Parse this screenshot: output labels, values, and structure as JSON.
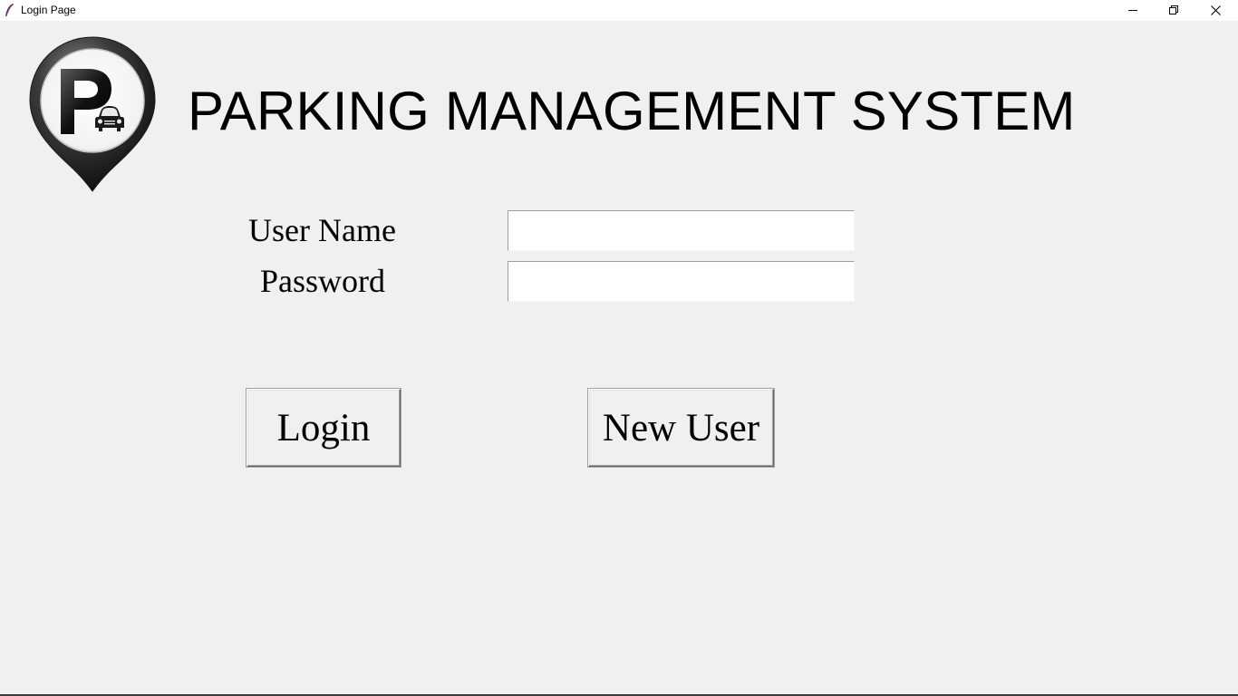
{
  "window": {
    "title": "Login Page",
    "minimize_icon": "minimize-icon",
    "restore_icon": "restore-icon",
    "close_icon": "close-icon"
  },
  "header": {
    "title": "PARKING MANAGEMENT SYSTEM",
    "logo_icon": "parking-pin-logo"
  },
  "form": {
    "username_label": "User Name",
    "username_value": "",
    "password_label": "Password",
    "password_value": ""
  },
  "buttons": {
    "login_label": "Login",
    "new_user_label": "New User"
  },
  "colors": {
    "background": "#f0f0f0",
    "titlebar": "#ffffff",
    "text": "#000000"
  }
}
